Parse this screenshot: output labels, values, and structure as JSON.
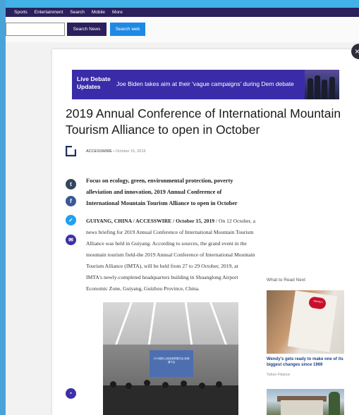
{
  "topnav": {
    "items": [
      "Sports",
      "Entertainment",
      "Search",
      "Mobile",
      "More"
    ]
  },
  "search": {
    "value": "",
    "news_button": "Search News",
    "web_button": "Search web"
  },
  "modal": {
    "close_symbol": "×"
  },
  "banner": {
    "live_label": "Live Debate Updates",
    "headline": "Joe Biden takes aim at their 'vague campaigns' during Dem debate"
  },
  "article": {
    "title": "2019 Annual Conference of International Mountain Tourism Alliance to open in October",
    "source": "ACCESSWIRE",
    "separator": "•",
    "date": "October 15, 2019",
    "summary": "Focus on ecology, green, environmental protection, poverty alleviation and innovation, 2019 Annual Conference of International Mountain Tourism Alliance to open in October",
    "dateline": "GUIYANG, CHINA / ACCESSWIRE / October 15, 2019",
    "body": "/ On 12 October, a news briefing for 2019 Annual Conference of International Mountain Tourism Alliance was held in Guiyang. According to sources, the grand event in the mountain tourism field-the 2019 Annual Conference of International Mountain Tourism Alliance (IMTA), will be held from 27 to 29 October, 2019, at IMTA's newly-completed headquarters building in Shuanglong Airport Economic Zone, Guiyang, Guizhou Province, China.",
    "photo_screen_text": "2019国际山地旅游联盟年会 新闻通气会"
  },
  "share": {
    "tumblr": "t",
    "facebook": "f",
    "twitter": "✓",
    "email": "✉",
    "comment": "▪"
  },
  "read_next": {
    "heading": "What to Read Next",
    "items": [
      {
        "title": "Wendy's gets ready to make one of its biggest changes since 1969",
        "source": "Yahoo Finance",
        "image_badge": "Wendy's"
      }
    ]
  },
  "icons": {
    "close": "close-icon",
    "tumblr": "tumblr-icon",
    "facebook": "facebook-icon",
    "twitter": "twitter-icon",
    "email": "email-icon",
    "comment": "comment-icon",
    "publisher_logo": "publisher-logo-icon"
  },
  "colors": {
    "nav_bg": "#2b1f5c",
    "search_web_bg": "#1e88e5",
    "banner_bg": "#3a2ba8",
    "tumblr": "#34465d",
    "facebook": "#3b5998",
    "twitter": "#1da1f2",
    "email": "#3d2fa8",
    "link": "#1a3f8f"
  }
}
